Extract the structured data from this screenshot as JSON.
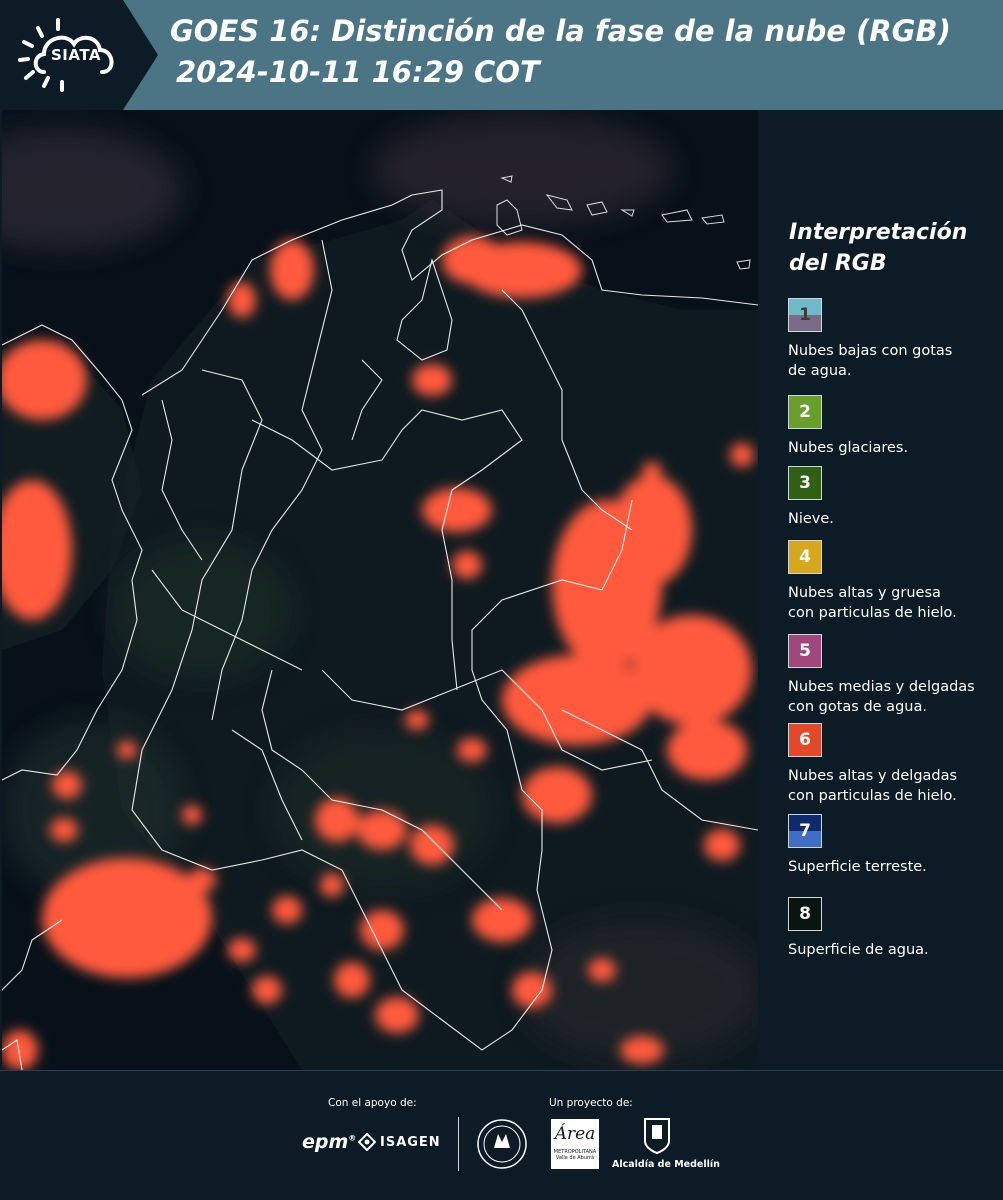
{
  "header": {
    "title_line1": "GOES 16: Distinción de la fase de la nube (RGB)",
    "title_line2": "2024-10-11 16:29 COT",
    "logo_text": "SIATA",
    "colors": {
      "band": "#4b7485",
      "logo_bg": "#0c1b26"
    }
  },
  "legend": {
    "title_line1": "Interpretación",
    "title_line2": "del RGB",
    "items": [
      {
        "number": "1",
        "label_lines": [
          "Nubes bajas con gotas",
          "de agua."
        ],
        "color_top": "#6fb9c9",
        "color_bottom": "#7b6a86",
        "text_color": "#3c3c3c"
      },
      {
        "number": "2",
        "label_lines": [
          "Nubes glaciares."
        ],
        "color_top": "#6a9e2c",
        "color_bottom": "#6a9e2c",
        "text_color": "#ffffff"
      },
      {
        "number": "3",
        "label_lines": [
          "Nieve."
        ],
        "color_top": "#2f6015",
        "color_bottom": "#2f6015",
        "text_color": "#ffffff"
      },
      {
        "number": "4",
        "label_lines": [
          "Nubes altas y gruesa",
          "con particulas de hielo."
        ],
        "color_top": "#d7a71e",
        "color_bottom": "#d7a71e",
        "text_color": "#ffffff"
      },
      {
        "number": "5",
        "label_lines": [
          "Nubes medias y delgadas",
          "con gotas de agua."
        ],
        "color_top": "#a0487d",
        "color_bottom": "#a0487d",
        "text_color": "#ffffff"
      },
      {
        "number": "6",
        "label_lines": [
          "Nubes altas y delgadas",
          "con particulas de hielo."
        ],
        "color_top": "#e2492a",
        "color_bottom": "#e2492a",
        "text_color": "#ffffff"
      },
      {
        "number": "7",
        "label_lines": [
          "Superficie terreste."
        ],
        "color_top": "#0e2a6b",
        "color_bottom": "#3f6ec4",
        "text_color": "#ffffff"
      },
      {
        "number": "8",
        "label_lines": [
          "Superficie de agua."
        ],
        "color_top": "#0a1410",
        "color_bottom": "#0a1410",
        "text_color": "#ffffff"
      }
    ]
  },
  "map": {
    "colors": {
      "background": "#08111a",
      "land": "#121d22",
      "cloud": "#ff5a3c",
      "cloud_edge": "#e63a28",
      "border": "#ffffff"
    }
  },
  "footer": {
    "support_caption": "Con el apoyo de:",
    "project_caption": "Un proyecto de:",
    "epm_logo_text": "epm",
    "isagen_logo_text": "ISAGEN",
    "area_logo_text": "Área",
    "area_logo_subtext": "METROPOLITANA",
    "area_logo_subtext2": "Valle de Aburrá",
    "alcaldia_logo_text": "Alcaldía de Medellín"
  }
}
